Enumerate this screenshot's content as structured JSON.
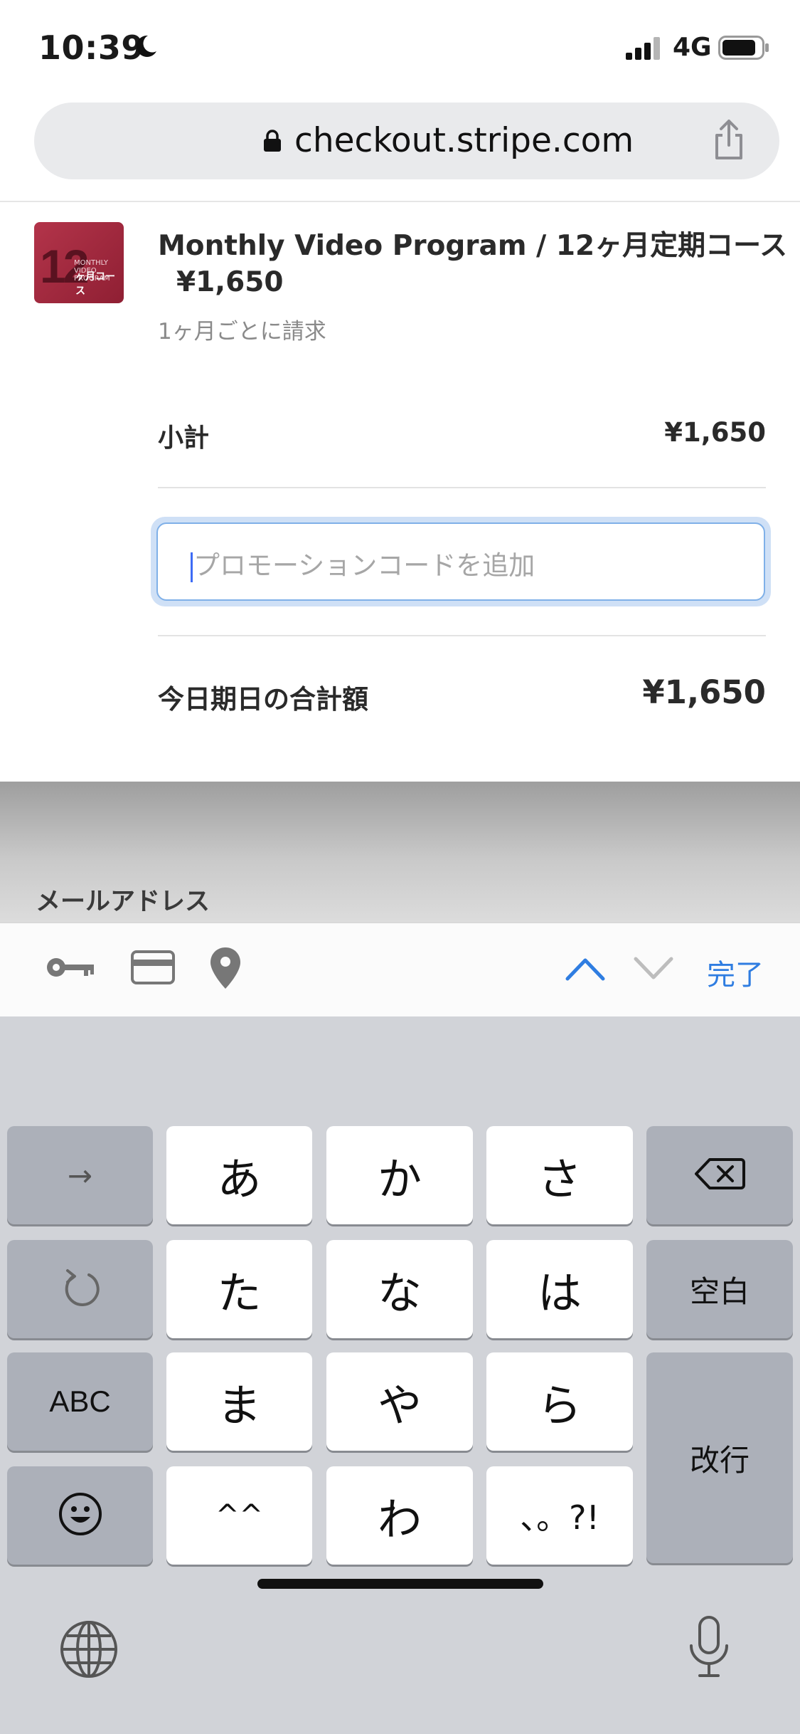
{
  "status_bar": {
    "time": "10:39",
    "network": "4G",
    "icons": [
      "moon-icon",
      "signal-icon",
      "battery-icon"
    ]
  },
  "browser": {
    "url": "checkout.stripe.com",
    "icons": [
      "lock-icon",
      "share-icon"
    ]
  },
  "product": {
    "thumbnail_number": "12",
    "thumbnail_text1": "MONTHLY VIDEO PROGRAM",
    "thumbnail_text2": "ヶ月コース",
    "name": "Monthly Video Program / 12ヶ月定期コース",
    "price": "¥1,650",
    "billing_note": "1ヶ月ごとに請求"
  },
  "summary": {
    "subtotal_label": "小計",
    "subtotal_value": "¥1,650",
    "promo_placeholder": "プロモーションコードを追加",
    "total_label": "今日期日の合計額",
    "total_value": "¥1,650"
  },
  "form": {
    "email_label": "メールアドレス"
  },
  "accessory_bar": {
    "icons": [
      "key-icon",
      "credit-card-icon",
      "location-pin-icon",
      "chevron-up-icon",
      "chevron-down-icon"
    ],
    "done_label": "完了"
  },
  "keyboard": {
    "rows": [
      [
        "→",
        "あ",
        "か",
        "さ",
        "⌫"
      ],
      [
        "↺",
        "た",
        "な",
        "は",
        "空白"
      ],
      [
        "ABC",
        "ま",
        "や",
        "ら",
        "改行"
      ],
      [
        "☺",
        "^^",
        "わ",
        "、。?!"
      ]
    ],
    "keys": {
      "arrow": "→",
      "a": "あ",
      "ka": "か",
      "sa": "さ",
      "ta": "た",
      "na": "な",
      "ha": "は",
      "space": "空白",
      "abc": "ABC",
      "ma": "ま",
      "ya": "や",
      "ra": "ら",
      "return": "改行",
      "kaomoji": "^^",
      "wa": "わ",
      "punct": "、。?!"
    },
    "icons": [
      "undo-icon",
      "delete-icon",
      "emoji-icon",
      "globe-icon",
      "microphone-icon"
    ]
  }
}
